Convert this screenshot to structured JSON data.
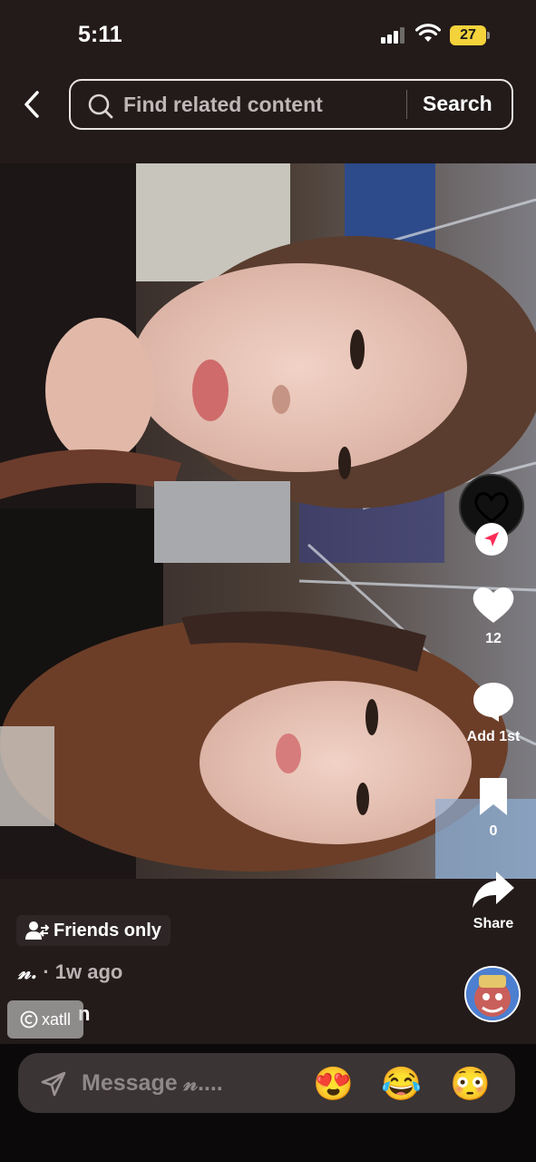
{
  "status_bar": {
    "time": "5:11",
    "battery": "27"
  },
  "search": {
    "placeholder": "Find related content",
    "button_label": "Search"
  },
  "actions": {
    "likes": "12",
    "comments": "Add 1st",
    "saves": "0",
    "share": "Share"
  },
  "post": {
    "visibility": "Friends only",
    "username": "𝓃.",
    "time_ago": "· 1w ago",
    "caption_fragment": "n",
    "watermark": "xatll"
  },
  "message": {
    "placeholder": "Message 𝓃....",
    "emojis": [
      "😍",
      "😂",
      "😳"
    ]
  },
  "colors": {
    "background": "#231a1a",
    "like_badge": "#fe2c55",
    "battery": "#f3d23b"
  }
}
